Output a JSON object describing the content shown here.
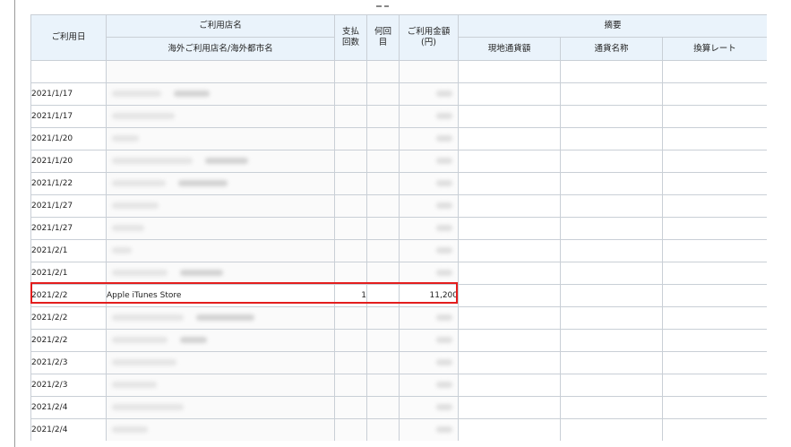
{
  "header": {
    "usage_date": "ご利用日",
    "store_name": "ご利用店名",
    "store_name_sub": "海外ご利用店名/海外都市名",
    "payment_count_l1": "支払",
    "payment_count_l2": "回数",
    "installment_l1": "何回",
    "installment_l2": "目",
    "amount_l1": "ご利用金額",
    "amount_l2": "(円)",
    "summary": "摘要",
    "local_amount": "現地通貨額",
    "currency_name": "通貨名称",
    "exchange_rate": "換算レート"
  },
  "rows": [
    {
      "date": "",
      "store": "",
      "count": "",
      "amount": ""
    },
    {
      "date": "2021/1/17",
      "store": "",
      "count": "",
      "amount": ""
    },
    {
      "date": "2021/1/17",
      "store": "",
      "count": "",
      "amount": ""
    },
    {
      "date": "2021/1/20",
      "store": "",
      "count": "",
      "amount": ""
    },
    {
      "date": "2021/1/20",
      "store": "",
      "count": "",
      "amount": ""
    },
    {
      "date": "2021/1/22",
      "store": "",
      "count": "",
      "amount": ""
    },
    {
      "date": "2021/1/27",
      "store": "",
      "count": "",
      "amount": ""
    },
    {
      "date": "2021/1/27",
      "store": "",
      "count": "",
      "amount": ""
    },
    {
      "date": "2021/2/1",
      "store": "",
      "count": "",
      "amount": ""
    },
    {
      "date": "2021/2/1",
      "store": "",
      "count": "",
      "amount": ""
    },
    {
      "date": "2021/2/2",
      "store": "Apple iTunes Store",
      "count": "1",
      "amount": "11,200"
    },
    {
      "date": "2021/2/2",
      "store": "",
      "count": "",
      "amount": ""
    },
    {
      "date": "2021/2/2",
      "store": "",
      "count": "",
      "amount": ""
    },
    {
      "date": "2021/2/3",
      "store": "",
      "count": "",
      "amount": ""
    },
    {
      "date": "2021/2/3",
      "store": "",
      "count": "",
      "amount": ""
    },
    {
      "date": "2021/2/4",
      "store": "",
      "count": "",
      "amount": ""
    },
    {
      "date": "2021/2/4",
      "store": "",
      "count": "",
      "amount": ""
    }
  ],
  "colors": {
    "header_bg": "#eaf3fb",
    "border": "#c9cfd6",
    "highlight": "#e31d1d"
  }
}
